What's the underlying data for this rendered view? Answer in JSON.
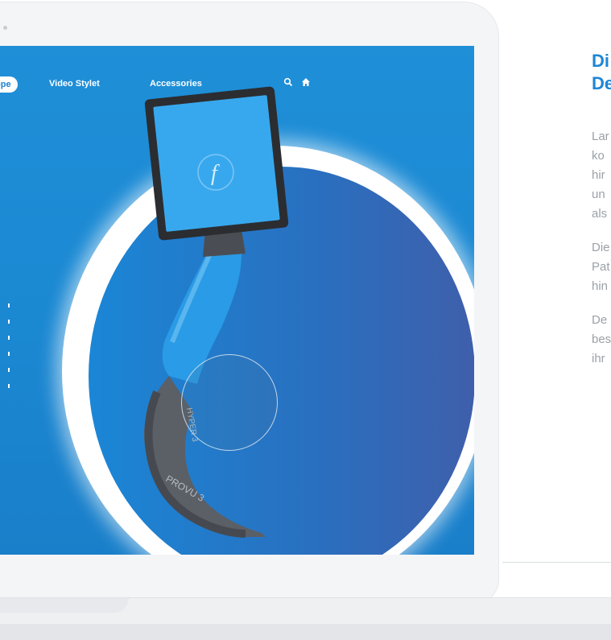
{
  "nav": {
    "active_label": "ope",
    "links": [
      "Video Stylet",
      "Accessories"
    ],
    "search_icon": "search-icon",
    "home_icon": "home-icon"
  },
  "device": {
    "screen_logo": "f",
    "handle_text": "HYPER 3",
    "blade_text": "PROVU 3"
  },
  "right_panel": {
    "heading": [
      "Di",
      "De"
    ],
    "para1": [
      "Lar",
      "ko",
      "hir",
      "un",
      "als"
    ],
    "para2": [
      "Die",
      "Pat",
      "hin"
    ],
    "para3": [
      "De",
      "bes",
      "ihr"
    ]
  },
  "colors": {
    "accent": "#1e86d6",
    "screen_bg": "#1f8fd8"
  }
}
